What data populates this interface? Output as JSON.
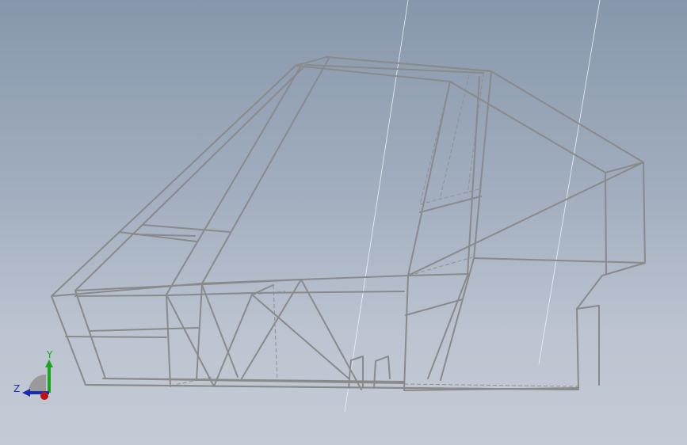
{
  "viewport": {
    "background_top": "#8797ab",
    "background_bottom": "#c4cbd6",
    "edge_color": "#8a8a8a",
    "hidden_edge_color": "#8f8f8f",
    "sketch_line_color": "#eef1f5"
  },
  "triad": {
    "y_label": "Y",
    "z_label": "Z",
    "y_color": "#1aa61a",
    "z_color": "#1c2ab0",
    "x_color": "#c01010",
    "icon": "coordinate-triad-icon"
  }
}
